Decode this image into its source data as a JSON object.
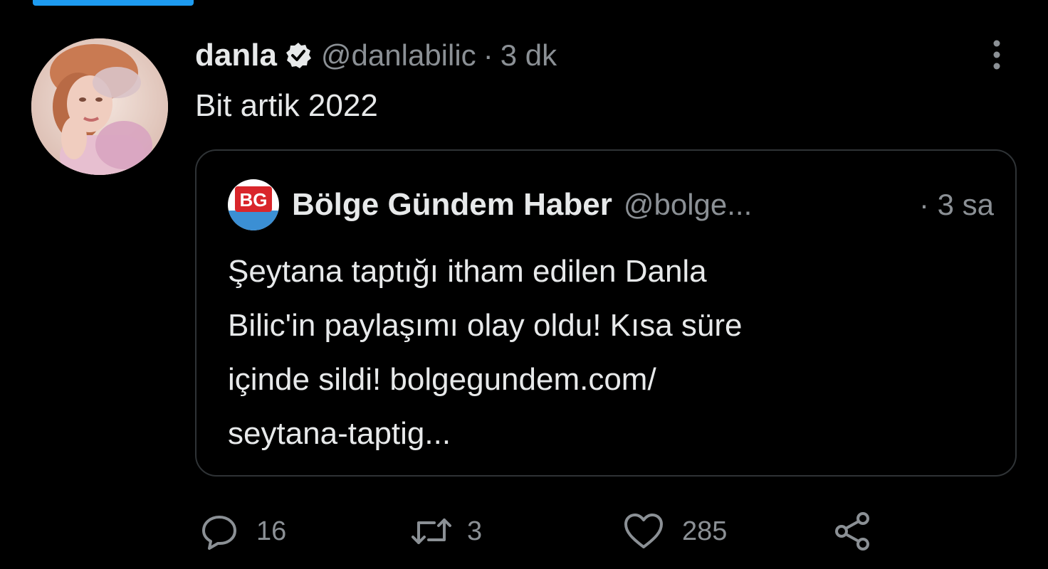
{
  "tweet": {
    "display_name": "danla",
    "verified_icon": "verified-badge-icon",
    "handle": "@danlabilic",
    "separator": "·",
    "time": "3 dk",
    "text": "Bit artik 2022",
    "avatar_alt": "profile-photo"
  },
  "quote": {
    "logo_text": "BG",
    "name": "Bölge Gündem Haber",
    "handle": "@bolge...",
    "time": "· 3 sa",
    "text_lines": [
      "Şeytana taptığı itham edilen Danla",
      "Bilic'in paylaşımı olay oldu! Kısa süre",
      "içinde sildi! bolgegundem.com/",
      "seytana-taptig..."
    ]
  },
  "actions": {
    "reply_count": "16",
    "retweet_count": "3",
    "like_count": "285"
  },
  "colors": {
    "background": "#000000",
    "text_primary": "#e7e9ea",
    "text_secondary": "#8b9095",
    "border": "#2f3336",
    "accent": "#1d9bf0"
  }
}
